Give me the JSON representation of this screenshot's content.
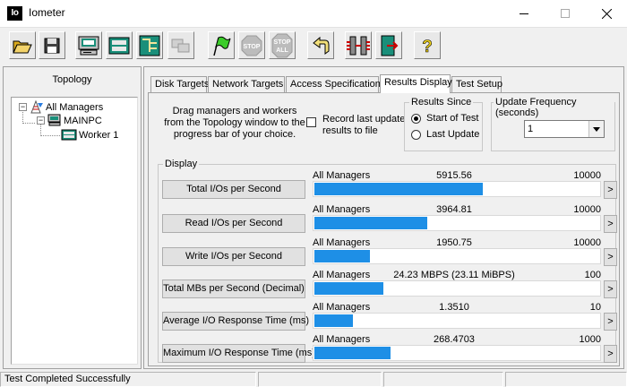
{
  "window": {
    "app_icon_text": "Io",
    "title": "Iometer"
  },
  "toolbar": {
    "buttons": [
      {
        "name": "open-config-button",
        "icon": "folder-open-icon"
      },
      {
        "name": "save-config-button",
        "icon": "floppy-disk-icon"
      },
      {
        "name": "new-manager-button",
        "icon": "display-manager-icon"
      },
      {
        "name": "new-worker-button",
        "icon": "worker-icon"
      },
      {
        "name": "new-network-worker-button",
        "icon": "network-worker-icon"
      },
      {
        "name": "duplicate-worker-button",
        "icon": "copy-worker-icon"
      },
      {
        "name": "start-tests-button",
        "icon": "green-flag-icon"
      },
      {
        "name": "stop-button",
        "icon": "stop-sign-icon",
        "label": "STOP"
      },
      {
        "name": "stop-all-button",
        "icon": "stop-all-sign-icon",
        "label": "STOP",
        "sublabel": "ALL"
      },
      {
        "name": "reset-workers-button",
        "icon": "reset-arrow-icon"
      },
      {
        "name": "disconnect-managers-button",
        "icon": "disconnect-icon"
      },
      {
        "name": "exit-button",
        "icon": "exit-door-icon"
      },
      {
        "name": "about-button",
        "icon": "question-mark-icon",
        "label": "?"
      }
    ]
  },
  "topology": {
    "header": "Topology",
    "root": {
      "toggle": "−",
      "label": "All Managers"
    },
    "manager": {
      "toggle": "−",
      "label": "MAINPC"
    },
    "worker": {
      "label": "Worker 1"
    }
  },
  "tabs": [
    {
      "label": "Disk Targets",
      "active": false
    },
    {
      "label": "Network Targets",
      "active": false
    },
    {
      "label": "Access Specifications",
      "active": false
    },
    {
      "label": "Results Display",
      "active": true
    },
    {
      "label": "Test Setup",
      "active": false
    }
  ],
  "results": {
    "hint": "Drag managers and workers from the Topology window to the progress bar of your choice.",
    "record_checkbox": {
      "label_line1": "Record last update",
      "label_line2": "results to file",
      "checked": false
    },
    "results_since": {
      "title": "Results Since",
      "options": [
        {
          "label": "Start of Test",
          "selected": true
        },
        {
          "label": "Last Update",
          "selected": false
        }
      ]
    },
    "update_frequency": {
      "title": "Update Frequency (seconds)",
      "value": "1"
    },
    "display": {
      "title": "Display",
      "bar_color": "#1e8fe6",
      "metrics": [
        {
          "button": "Total I/Os per Second",
          "target": "All Managers",
          "value": "5915.56",
          "max": "10000",
          "fraction": 0.5916
        },
        {
          "button": "Read I/Os per Second",
          "target": "All Managers",
          "value": "3964.81",
          "max": "10000",
          "fraction": 0.3965
        },
        {
          "button": "Write I/Os per Second",
          "target": "All Managers",
          "value": "1950.75",
          "max": "10000",
          "fraction": 0.1951
        },
        {
          "button": "Total MBs per Second (Decimal)",
          "target": "All Managers",
          "value": "24.23 MBPS (23.11 MiBPS)",
          "max": "100",
          "fraction": 0.2423
        },
        {
          "button": "Average I/O Response Time (ms)",
          "target": "All Managers",
          "value": "1.3510",
          "max": "10",
          "fraction": 0.1351
        },
        {
          "button": "Maximum I/O Response Time (ms)",
          "target": "All Managers",
          "value": "268.4703",
          "max": "1000",
          "fraction": 0.2685
        }
      ],
      "arrow": ">"
    }
  },
  "status": {
    "message": "Test Completed Successfully"
  }
}
